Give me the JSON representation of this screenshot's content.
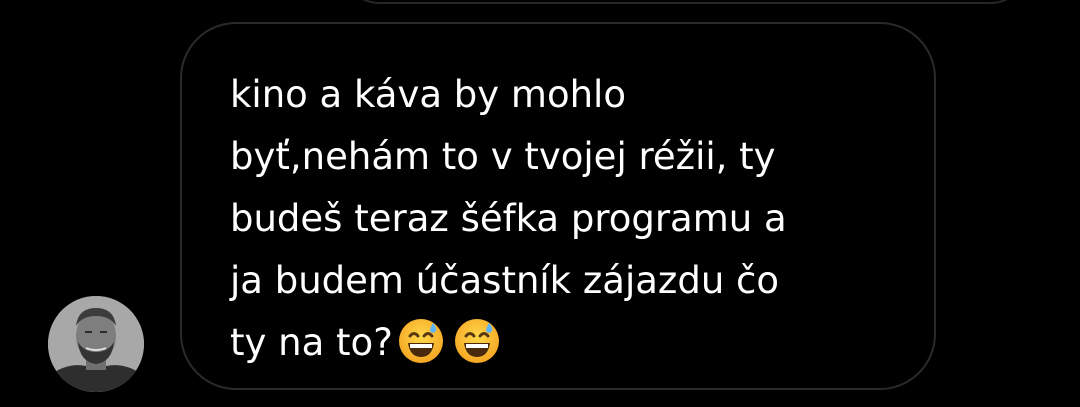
{
  "message": {
    "text": "kino a káva by mohlo\nbyť,nehám to v tvojej réžii, ty\nbudeš teraz šéfka programu a\nja budem účastník zájazdu čo\nty na to?",
    "emojis": [
      "grinning-face-with-sweat-icon",
      "grinning-face-with-sweat-icon"
    ]
  },
  "sender": {
    "avatar_icon": "profile-photo-man-bearded"
  },
  "colors": {
    "background": "#000000",
    "bubble_border": "#2a2a2a",
    "text": "#ffffff"
  }
}
